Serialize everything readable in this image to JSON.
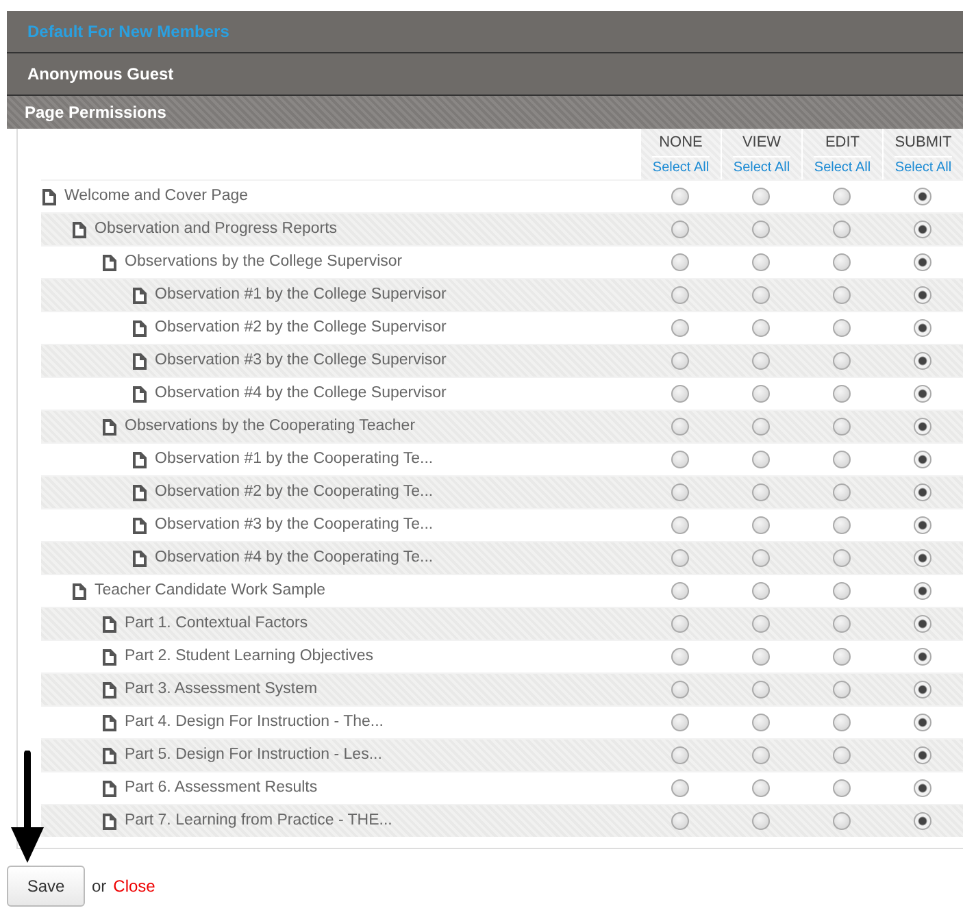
{
  "sections": [
    {
      "title": "Default For New Members",
      "kind": "link"
    },
    {
      "title": "Anonymous Guest",
      "kind": "plain"
    }
  ],
  "panel": {
    "title": "Page Permissions",
    "columns": [
      {
        "label": "NONE",
        "action": "Select All"
      },
      {
        "label": "VIEW",
        "action": "Select All"
      },
      {
        "label": "EDIT",
        "action": "Select All"
      },
      {
        "label": "SUBMIT",
        "action": "Select All"
      }
    ],
    "pages": [
      {
        "title": "Welcome and Cover Page",
        "options": [
          {
            "selected": false
          },
          {
            "selected": false
          },
          {
            "selected": false
          },
          {
            "selected": true
          }
        ],
        "children": [
          {
            "title": "Observation and Progress Reports",
            "options": [
              {
                "selected": false
              },
              {
                "selected": false
              },
              {
                "selected": false
              },
              {
                "selected": true
              }
            ],
            "children": [
              {
                "title": "Observations by the College Supervisor",
                "options": [
                  {
                    "selected": false
                  },
                  {
                    "selected": false
                  },
                  {
                    "selected": false
                  },
                  {
                    "selected": true
                  }
                ],
                "children": [
                  {
                    "title": "Observation #1 by the College Supervisor",
                    "options": [
                      {
                        "selected": false
                      },
                      {
                        "selected": false
                      },
                      {
                        "selected": false
                      },
                      {
                        "selected": true
                      }
                    ]
                  },
                  {
                    "title": "Observation #2 by the College Supervisor",
                    "options": [
                      {
                        "selected": false
                      },
                      {
                        "selected": false
                      },
                      {
                        "selected": false
                      },
                      {
                        "selected": true
                      }
                    ]
                  },
                  {
                    "title": "Observation #3 by the College Supervisor",
                    "options": [
                      {
                        "selected": false
                      },
                      {
                        "selected": false
                      },
                      {
                        "selected": false
                      },
                      {
                        "selected": true
                      }
                    ]
                  },
                  {
                    "title": "Observation #4 by the College Supervisor",
                    "options": [
                      {
                        "selected": false
                      },
                      {
                        "selected": false
                      },
                      {
                        "selected": false
                      },
                      {
                        "selected": true
                      }
                    ]
                  }
                ]
              },
              {
                "title": "Observations by the Cooperating Teacher",
                "options": [
                  {
                    "selected": false
                  },
                  {
                    "selected": false
                  },
                  {
                    "selected": false
                  },
                  {
                    "selected": true
                  }
                ],
                "children": [
                  {
                    "title": "Observation #1 by the Cooperating Te...",
                    "options": [
                      {
                        "selected": false
                      },
                      {
                        "selected": false
                      },
                      {
                        "selected": false
                      },
                      {
                        "selected": true
                      }
                    ]
                  },
                  {
                    "title": "Observation #2 by the Cooperating Te...",
                    "options": [
                      {
                        "selected": false
                      },
                      {
                        "selected": false
                      },
                      {
                        "selected": false
                      },
                      {
                        "selected": true
                      }
                    ]
                  },
                  {
                    "title": "Observation #3 by the Cooperating Te...",
                    "options": [
                      {
                        "selected": false
                      },
                      {
                        "selected": false
                      },
                      {
                        "selected": false
                      },
                      {
                        "selected": true
                      }
                    ]
                  },
                  {
                    "title": "Observation #4 by the Cooperating Te...",
                    "options": [
                      {
                        "selected": false
                      },
                      {
                        "selected": false
                      },
                      {
                        "selected": false
                      },
                      {
                        "selected": true
                      }
                    ]
                  }
                ]
              }
            ]
          },
          {
            "title": "Teacher Candidate Work Sample",
            "options": [
              {
                "selected": false
              },
              {
                "selected": false
              },
              {
                "selected": false
              },
              {
                "selected": true
              }
            ],
            "children": [
              {
                "title": "Part 1. Contextual Factors",
                "options": [
                  {
                    "selected": false
                  },
                  {
                    "selected": false
                  },
                  {
                    "selected": false
                  },
                  {
                    "selected": true
                  }
                ]
              },
              {
                "title": "Part 2. Student Learning Objectives",
                "options": [
                  {
                    "selected": false
                  },
                  {
                    "selected": false
                  },
                  {
                    "selected": false
                  },
                  {
                    "selected": true
                  }
                ]
              },
              {
                "title": "Part 3. Assessment System",
                "options": [
                  {
                    "selected": false
                  },
                  {
                    "selected": false
                  },
                  {
                    "selected": false
                  },
                  {
                    "selected": true
                  }
                ]
              },
              {
                "title": "Part 4. Design For Instruction - The...",
                "options": [
                  {
                    "selected": false
                  },
                  {
                    "selected": false
                  },
                  {
                    "selected": false
                  },
                  {
                    "selected": true
                  }
                ]
              },
              {
                "title": "Part 5. Design For Instruction - Les...",
                "options": [
                  {
                    "selected": false
                  },
                  {
                    "selected": false
                  },
                  {
                    "selected": false
                  },
                  {
                    "selected": true
                  }
                ]
              },
              {
                "title": "Part 6. Assessment Results",
                "options": [
                  {
                    "selected": false
                  },
                  {
                    "selected": false
                  },
                  {
                    "selected": false
                  },
                  {
                    "selected": true
                  }
                ]
              },
              {
                "title": "Part 7. Learning from Practice - THE...",
                "options": [
                  {
                    "selected": false
                  },
                  {
                    "selected": false
                  },
                  {
                    "selected": false
                  },
                  {
                    "selected": true
                  }
                ]
              }
            ]
          }
        ]
      }
    ]
  },
  "footer": {
    "save": "Save",
    "joiner": "or",
    "close": "Close"
  }
}
